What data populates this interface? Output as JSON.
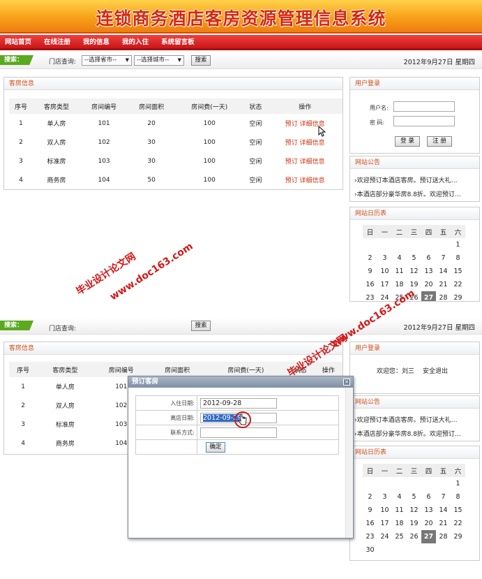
{
  "banner": {
    "title": "连锁商务酒店客房资源管理信息系统"
  },
  "nav": {
    "items": [
      "网站首页",
      "在线注册",
      "我的信息",
      "我的入住",
      "系统留言板"
    ]
  },
  "search": {
    "tag": "搜索：",
    "label": "门店查询:",
    "province": "--选择省市--",
    "city": "--选择城市--",
    "button": "搜索"
  },
  "date": "2012年9月27日 星期四",
  "rooms": {
    "title": "客房信息",
    "columns": [
      "序号",
      "客房类型",
      "房间编号",
      "房间面积",
      "房间费(一天)",
      "状态",
      "操作"
    ],
    "rows": [
      {
        "no": "1",
        "type": "单人房",
        "code": "101",
        "area": "20",
        "fee": "100",
        "status": "空闲",
        "book": "预订",
        "detail": "详细信息"
      },
      {
        "no": "2",
        "type": "双人房",
        "code": "102",
        "area": "30",
        "fee": "100",
        "status": "空闲",
        "book": "预订",
        "detail": "详细信息"
      },
      {
        "no": "3",
        "type": "标准房",
        "code": "103",
        "area": "30",
        "fee": "100",
        "status": "空闲",
        "book": "预订",
        "detail": "详细信息"
      },
      {
        "no": "4",
        "type": "商务房",
        "code": "104",
        "area": "50",
        "fee": "100",
        "status": "空闲",
        "book": "预订",
        "detail": "详细信息"
      }
    ]
  },
  "login": {
    "title": "用户登录",
    "user_label": "用户名:",
    "pwd_label": "密  码:",
    "login_btn": "登 录",
    "register_btn": "注 册",
    "welcome": "欢迎您：刘三",
    "logout": "安全退出"
  },
  "notice": {
    "title": "网站公告",
    "items": [
      "欢迎预订本酒店客房。预订送大礼…",
      "本酒店部分豪华房8.8折。欢迎预订…"
    ]
  },
  "calendar": {
    "title": "网站日历表",
    "weekdays": [
      "日",
      "一",
      "二",
      "三",
      "四",
      "五",
      "六"
    ],
    "today": "27",
    "rows": [
      [
        "",
        "",
        "",
        "",
        "",
        "",
        "1"
      ],
      [
        "2",
        "3",
        "4",
        "5",
        "6",
        "7",
        "8"
      ],
      [
        "9",
        "10",
        "11",
        "12",
        "13",
        "14",
        "15"
      ],
      [
        "16",
        "17",
        "18",
        "19",
        "20",
        "21",
        "22"
      ],
      [
        "23",
        "24",
        "25",
        "26",
        "27",
        "28",
        "29"
      ],
      [
        "30",
        "",
        "",
        "",
        "",
        "",
        ""
      ]
    ]
  },
  "dialog": {
    "title": "预订客房",
    "close": "×",
    "checkin_label": "入住日期:",
    "checkin_value": "2012-09-28",
    "checkout_label": "离店日期:",
    "checkout_value": "2012-09-29",
    "contact_label": "联系方式:",
    "contact_value": "",
    "confirm": "确定"
  },
  "watermark": {
    "line1": "毕业设计论文网",
    "line2": "www.doc163.com"
  },
  "colors": {
    "banner": "#f7a019",
    "nav": "#d91f1f",
    "accent": "#d04a12",
    "search_tag": "#5aa91f"
  }
}
